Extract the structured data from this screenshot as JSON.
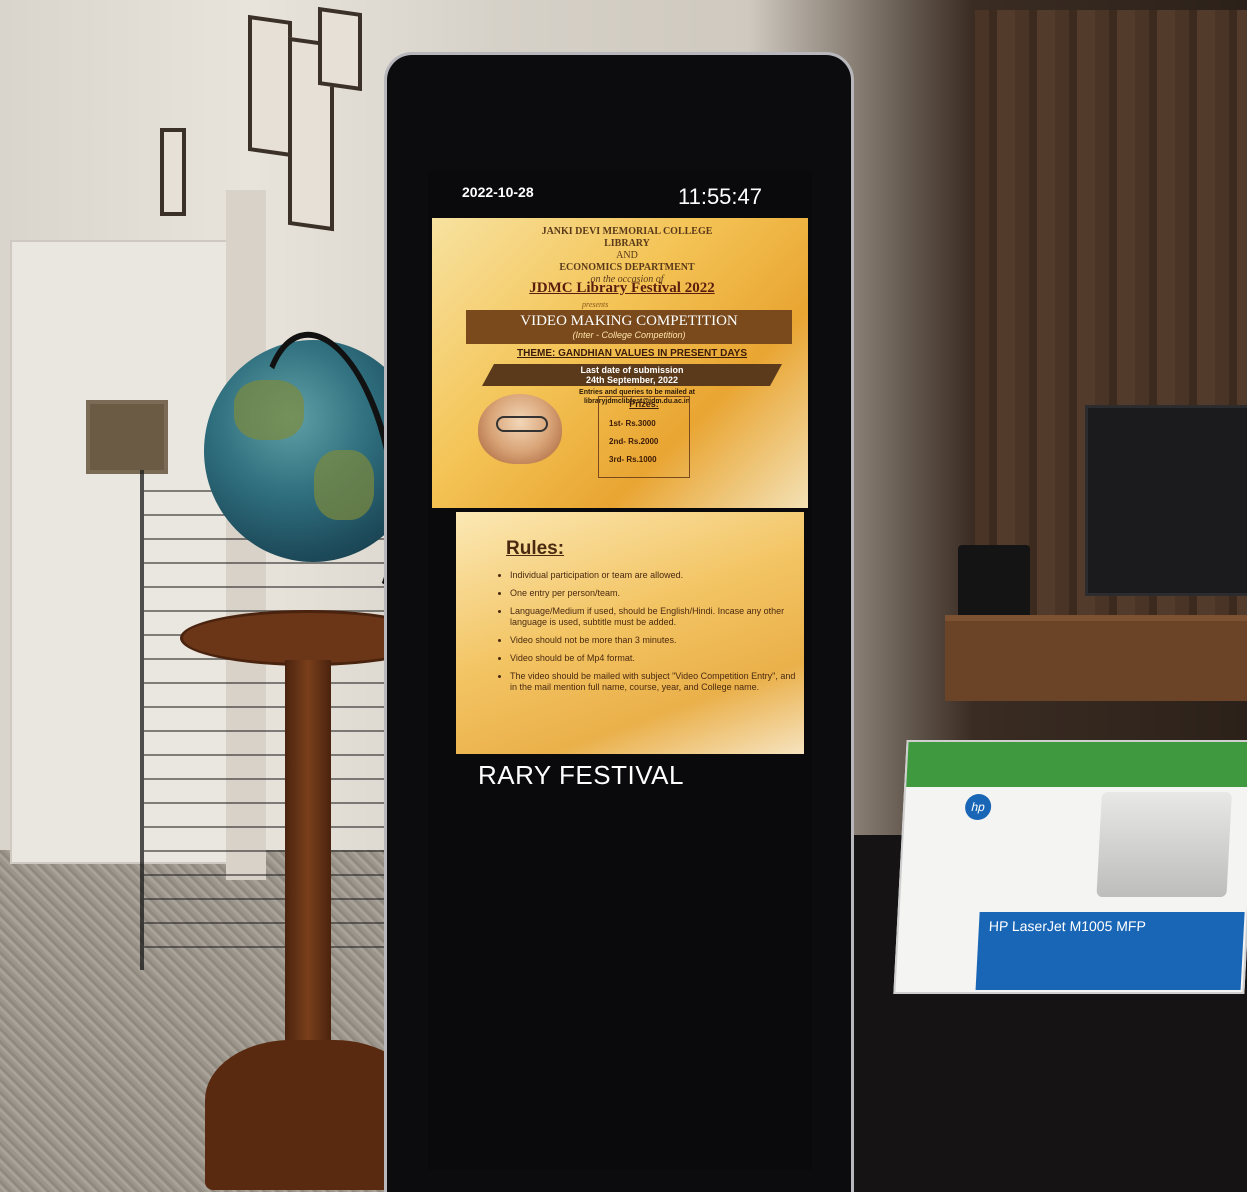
{
  "display": {
    "date": "2022-10-28",
    "time": "11:55:47",
    "ticker_text": "RARY FESTIVAL"
  },
  "poster_competition": {
    "college_lines": [
      "JANKI DEVI MEMORIAL COLLEGE",
      "LIBRARY",
      "AND",
      "ECONOMICS DEPARTMENT",
      "on the occasion of"
    ],
    "festival": "JDMC Library Festival 2022",
    "presents": "presents",
    "competition": "VIDEO MAKING COMPETITION",
    "subtitle": "(Inter - College Competition)",
    "theme": "THEME: GANDHIAN VALUES IN PRESENT DAYS",
    "deadline_line1": "Last date of submission",
    "deadline_line2": "24th September, 2022",
    "mail_line1": "Entries and queries to be mailed at",
    "mail_line2": "libraryjdmclibfest@jdm.du.ac.in",
    "prizes_heading": "Prizes:",
    "prizes": [
      "1st- Rs.3000",
      "2nd- Rs.2000",
      "3rd- Rs.1000"
    ]
  },
  "poster_rules": {
    "heading": "Rules:",
    "items": [
      "Individual participation or team are allowed.",
      "One entry per person/team.",
      "Language/Medium if used, should be English/Hindi. Incase any other language is used, subtitle must be added.",
      "Video should not be more than 3 minutes.",
      "Video should be of Mp4 format.",
      "The video should be mailed with subject \"Video Competition Entry\", and in the mail mention full name, course, year, and College name."
    ]
  },
  "printer_box": {
    "logo": "hp",
    "label": "HP LaserJet M1005 MFP"
  },
  "colors": {
    "kiosk_body": "#0c0c0f",
    "poster_orange": "#f4c456",
    "poster_brown": "#7a4a1c",
    "hp_blue": "#1a66b6"
  }
}
